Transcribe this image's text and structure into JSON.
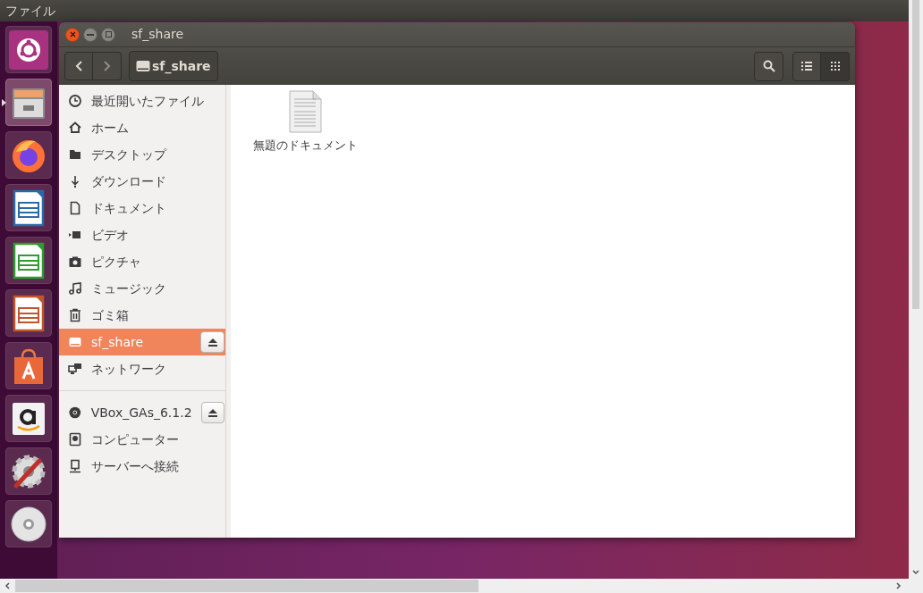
{
  "top_bar": {
    "menu": "ファイル"
  },
  "launcher": [
    {
      "kind": "ubuntu",
      "active": false
    },
    {
      "kind": "files",
      "active": true
    },
    {
      "kind": "firefox",
      "active": false
    },
    {
      "kind": "writer",
      "active": false
    },
    {
      "kind": "calc",
      "active": false
    },
    {
      "kind": "impress",
      "active": false
    },
    {
      "kind": "store",
      "active": false
    },
    {
      "kind": "amazon",
      "active": false
    },
    {
      "kind": "settings",
      "active": false
    },
    {
      "kind": "disc",
      "active": false
    }
  ],
  "window": {
    "title": "sf_share",
    "path_button": "sf_share",
    "view_buttons": [
      {
        "kind": "list",
        "selected": false
      },
      {
        "kind": "grid",
        "selected": true
      }
    ]
  },
  "sidebar": [
    [
      {
        "kind": "recent",
        "label": "最近開いたファイル",
        "selected": false,
        "eject": false
      },
      {
        "kind": "home",
        "label": "ホーム",
        "selected": false,
        "eject": false
      },
      {
        "kind": "folder",
        "label": "デスクトップ",
        "selected": false,
        "eject": false
      },
      {
        "kind": "download",
        "label": "ダウンロード",
        "selected": false,
        "eject": false
      },
      {
        "kind": "document",
        "label": "ドキュメント",
        "selected": false,
        "eject": false
      },
      {
        "kind": "video",
        "label": "ビデオ",
        "selected": false,
        "eject": false
      },
      {
        "kind": "camera",
        "label": "ピクチャ",
        "selected": false,
        "eject": false
      },
      {
        "kind": "music",
        "label": "ミュージック",
        "selected": false,
        "eject": false
      },
      {
        "kind": "trash",
        "label": "ゴミ箱",
        "selected": false,
        "eject": false
      },
      {
        "kind": "drive",
        "label": "sf_share",
        "selected": true,
        "eject": true
      },
      {
        "kind": "network",
        "label": "ネットワーク",
        "selected": false,
        "eject": false
      }
    ],
    [
      {
        "kind": "disc",
        "label": "VBox_GAs_6.1.2",
        "selected": false,
        "eject": true
      },
      {
        "kind": "computer",
        "label": "コンピューター",
        "selected": false,
        "eject": false
      },
      {
        "kind": "server",
        "label": "サーバーへ接続",
        "selected": false,
        "eject": false
      }
    ]
  ],
  "files": [
    {
      "name": "無題のドキュメント"
    }
  ]
}
